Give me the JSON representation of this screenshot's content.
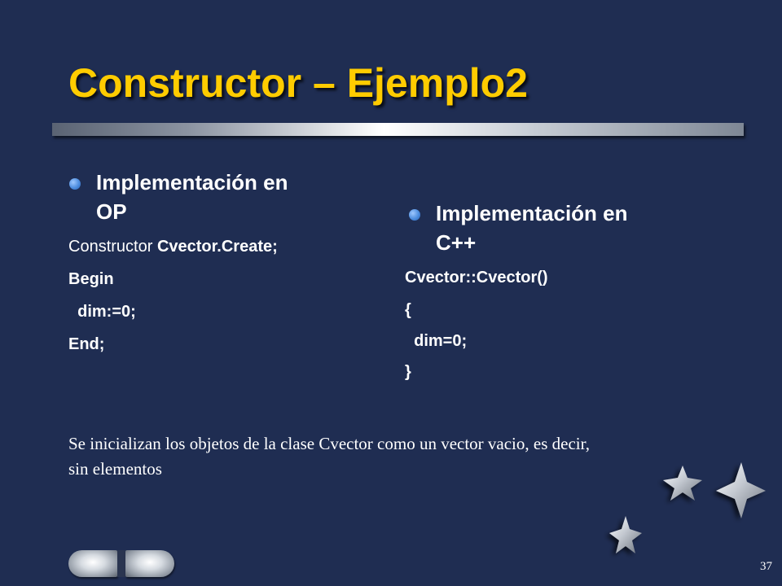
{
  "slide": {
    "title": "Constructor – Ejemplo2",
    "page_number": "37"
  },
  "left_column": {
    "bullet_line1": "Implementación en",
    "bullet_line2": "OP",
    "code": {
      "line1_keyword": "Constructor ",
      "line1_name": "Cvector.Create;",
      "line2": "Begin",
      "line3": "  dim:=0;",
      "line4": "End;"
    }
  },
  "right_column": {
    "bullet_line1": "Implementación en",
    "bullet_line2": "C++",
    "code": {
      "line1": "Cvector::Cvector()",
      "line2": "{",
      "line3": "  dim=0;",
      "line4": "}"
    }
  },
  "note": {
    "line1": "Se inicializan los objetos de la clase Cvector como un vector vacio, es decir,",
    "line2": "sin elementos"
  },
  "icons": {
    "nav_prev": "previous-slide-icon",
    "nav_next": "next-slide-icon",
    "decoration": "star-icon"
  },
  "colors": {
    "background": "#1f2d52",
    "title": "#ffcc00",
    "text": "#ffffff",
    "bullet": "#4d8dde"
  }
}
